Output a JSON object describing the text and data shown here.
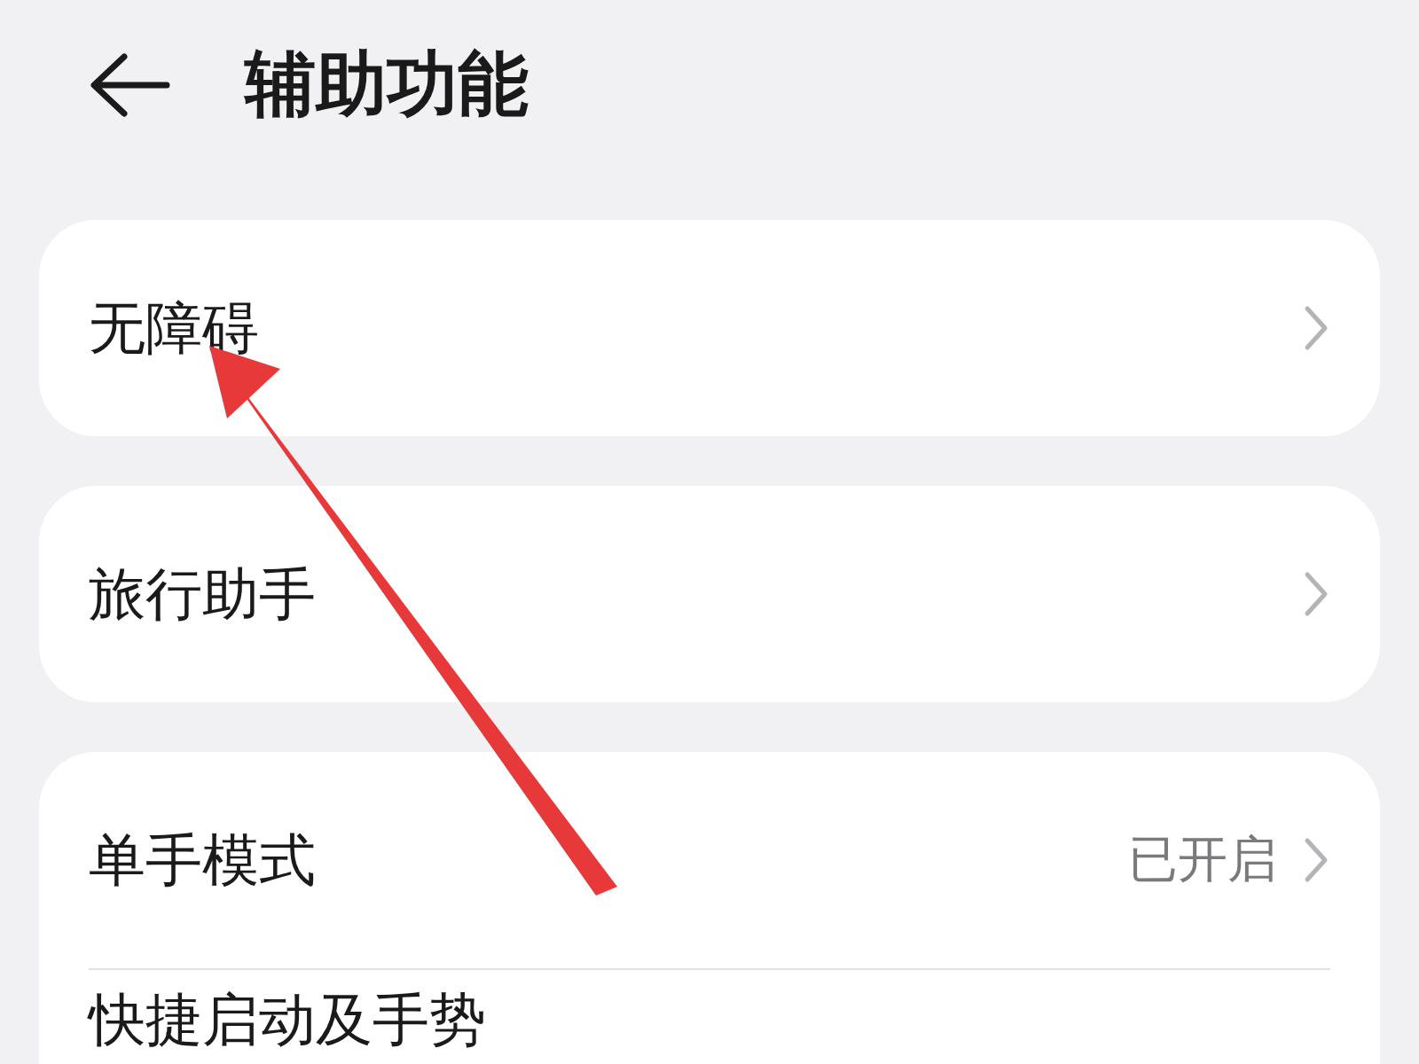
{
  "header": {
    "title": "辅助功能"
  },
  "groups": [
    {
      "items": [
        {
          "label": "无障碍",
          "chevron": true
        }
      ]
    },
    {
      "items": [
        {
          "label": "旅行助手",
          "chevron": true
        }
      ]
    },
    {
      "items": [
        {
          "label": "单手模式",
          "value": "已开启",
          "chevron": true
        },
        {
          "label": "快捷启动及手势",
          "chevron": false
        }
      ]
    }
  ]
}
